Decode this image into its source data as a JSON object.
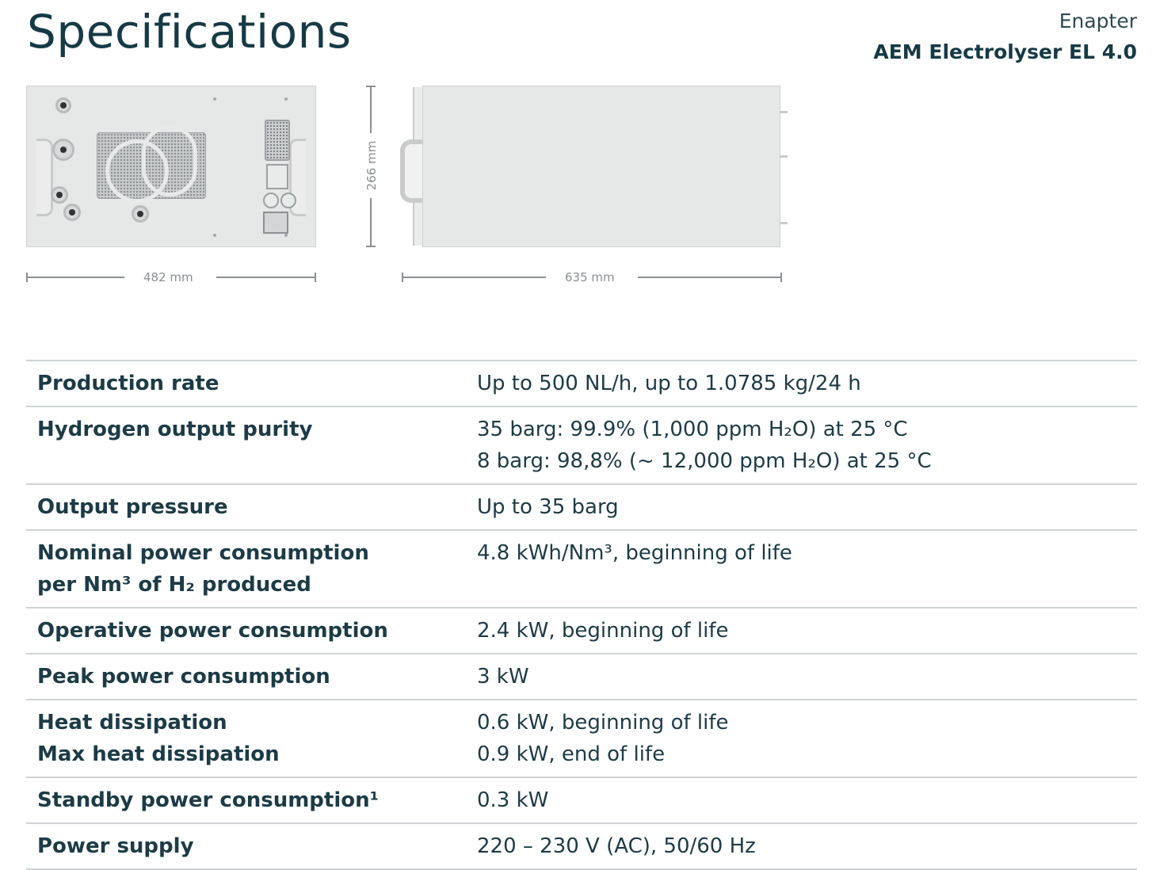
{
  "header": {
    "title": "Specifications",
    "company": "Enapter",
    "product": "AEM Electrolyser EL 4.0"
  },
  "dimensions": {
    "width_label": "482 mm",
    "depth_label": "635 mm",
    "height_label": "266 mm"
  },
  "specs": [
    {
      "label": [
        "Production rate"
      ],
      "value": [
        "Up to 500 NL/h, up to 1.0785 kg/24 h"
      ]
    },
    {
      "label": [
        "Hydrogen output purity"
      ],
      "value": [
        "35 barg: 99.9% (1,000 ppm H₂O) at 25 °C",
        "8 barg: 98,8% (~ 12,000 ppm H₂O) at 25 °C"
      ]
    },
    {
      "label": [
        "Output pressure"
      ],
      "value": [
        "Up to 35 barg"
      ]
    },
    {
      "label": [
        "Nominal power consumption",
        "per Nm³ of H₂ produced"
      ],
      "value": [
        "4.8 kWh/Nm³, beginning of life"
      ]
    },
    {
      "label": [
        "Operative power consumption"
      ],
      "value": [
        "2.4 kW, beginning of life"
      ]
    },
    {
      "label": [
        "Peak power consumption"
      ],
      "value": [
        "3 kW"
      ]
    },
    {
      "label": [
        "Heat dissipation",
        "Max heat dissipation"
      ],
      "value": [
        "0.6 kW, beginning of life",
        "0.9 kW, end of life"
      ]
    },
    {
      "label": [
        "Standby power consumption¹"
      ],
      "value": [
        "0.3 kW"
      ]
    },
    {
      "label": [
        "Power supply"
      ],
      "value": [
        "220 – 230 V (AC), 50/60 Hz"
      ]
    }
  ],
  "colors": {
    "text": "#1c3b46",
    "rule": "#cfd3d5",
    "device": "#e6e7e7"
  }
}
